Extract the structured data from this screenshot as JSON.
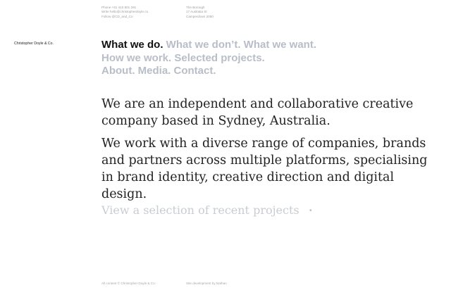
{
  "header": {
    "contact_left": [
      "Phone +61 410 801 291",
      "Write hello@christopherdoyle.co",
      "Follow @CD_and_Co"
    ],
    "contact_right": [
      "The Borough",
      "17 Australia St",
      "Camperdown 2050"
    ]
  },
  "brand": "Christopher Doyle & Co.",
  "nav": {
    "items": [
      {
        "label": "What we do.",
        "active": true
      },
      {
        "label": "What we don’t.",
        "active": false
      },
      {
        "label": "What we want.",
        "active": false
      },
      {
        "label": "How we work.",
        "active": false
      },
      {
        "label": "Selected projects.",
        "active": false
      },
      {
        "label": "About.",
        "active": false
      },
      {
        "label": "Media.",
        "active": false
      },
      {
        "label": "Contact.",
        "active": false
      }
    ]
  },
  "intro": {
    "paragraph1": "We are an independent and collaborative creative company based in Sydney, Australia.",
    "paragraph2": "We work with a diverse range of companies, brands and partners across multiple platforms, specialising in brand identity, creative direction and digital design."
  },
  "cta": {
    "label": "View a selection of recent projects",
    "icon": "•"
  },
  "footer": {
    "left": "All content © Christopher Doyle & Co.",
    "right": "Site development by Nathan"
  },
  "colors": {
    "active_nav": "#111111",
    "inactive_nav": "#b8bec8",
    "cta": "#c9ccd1"
  }
}
